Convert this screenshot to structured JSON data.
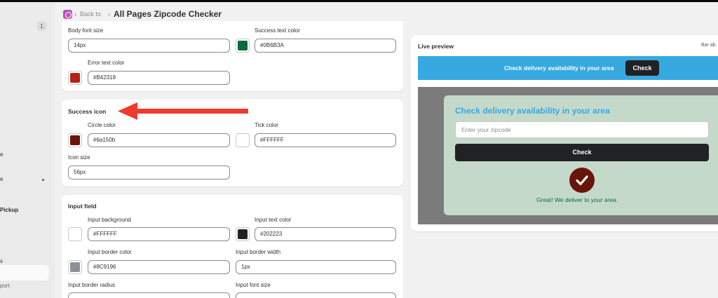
{
  "header": {
    "back_label": "Back to",
    "title": "All Pages Zipcode Checker"
  },
  "sidebar": {
    "badge": "1",
    "items": [
      {
        "label": "e"
      },
      {
        "label": "e"
      },
      {
        "label": "Pickup"
      },
      {
        "label": "s"
      },
      {
        "label": "port"
      }
    ]
  },
  "settings": {
    "text_colors": {
      "body_font_size_label": "Body font size",
      "body_font_size_value": "14px",
      "success_text_color_label": "Success text color",
      "success_text_color_value": "#0B6B3A",
      "error_text_color_label": "Error text color",
      "error_text_color_value": "#B42318"
    },
    "success_icon": {
      "title": "Success icon",
      "circle_color_label": "Circle color",
      "circle_color_value": "#6a150b",
      "tick_color_label": "Tick color",
      "tick_color_value": "#FFFFFF",
      "icon_size_label": "Icon size",
      "icon_size_value": "56px"
    },
    "input_field": {
      "title": "Input field",
      "input_background_label": "Input background",
      "input_background_value": "#FFFFFF",
      "input_text_color_label": "Input text color",
      "input_text_color_value": "#202223",
      "input_border_color_label": "Input border color",
      "input_border_color_value": "#8C9196",
      "input_border_width_label": "Input border width",
      "input_border_width_value": "1px",
      "input_border_radius_label": "Input border radius",
      "input_font_size_label": "Input font size"
    }
  },
  "preview": {
    "title": "Live preview",
    "tab_label": "Bar ab",
    "bar_text": "Check delivery availability in your area",
    "bar_button": "Check",
    "modal_title": "Check delivery availability in your area",
    "input_placeholder": "Enter your zipcode",
    "modal_button": "Check",
    "success_message": "Great! We deliver to your area."
  },
  "colors": {
    "accent_blue": "#36a9e1",
    "annotation_red": "#ee3b2f"
  }
}
